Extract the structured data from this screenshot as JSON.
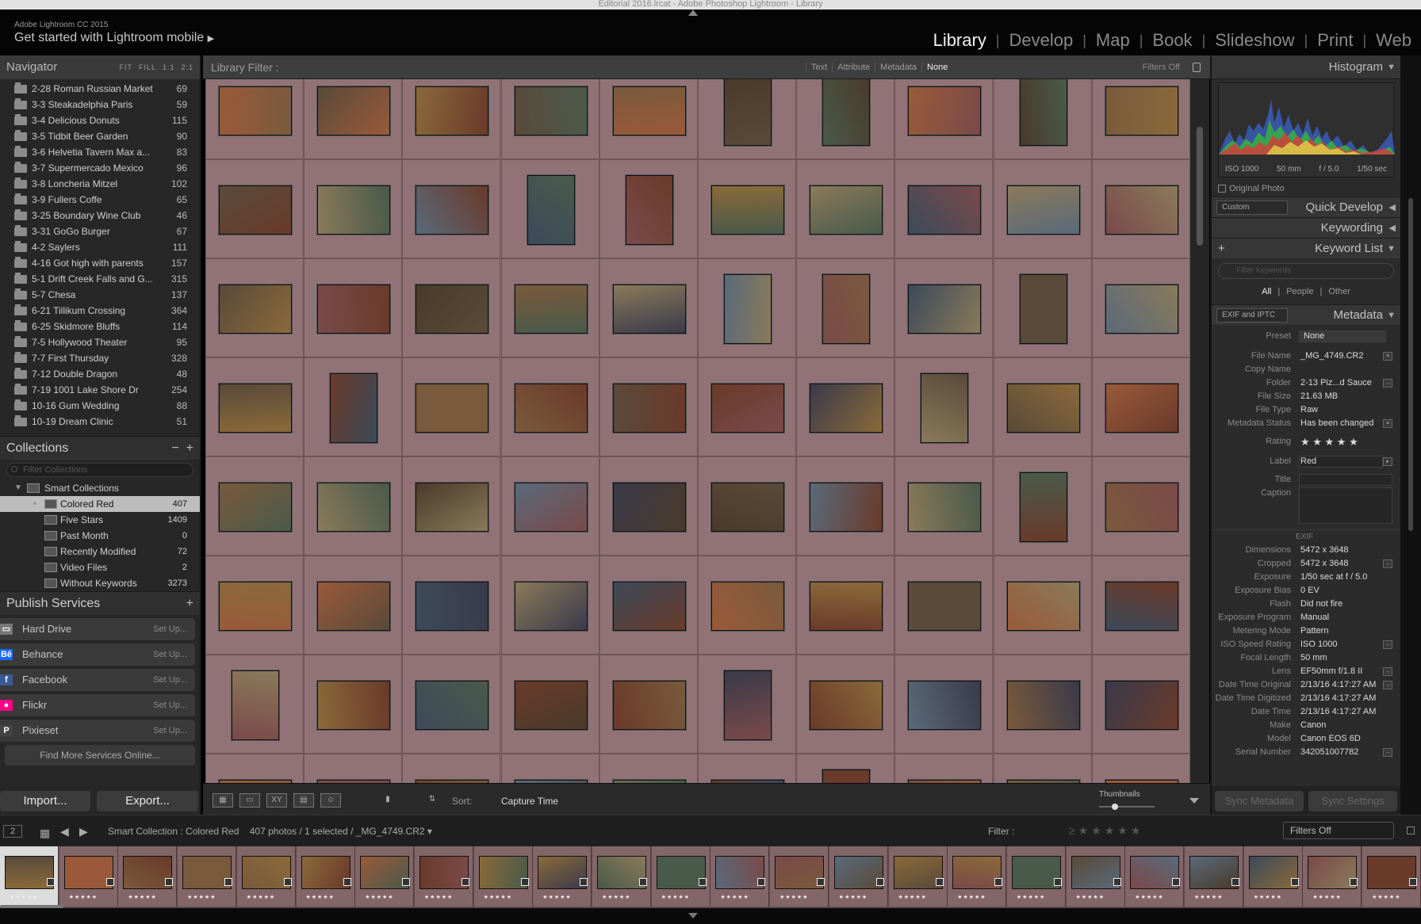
{
  "window": {
    "title": "Editorial 2016.lrcat - Adobe Photoshop Lightroom - Library"
  },
  "identity": {
    "app": "Adobe Lightroom CC 2015",
    "mobile_prompt": "Get started with Lightroom mobile"
  },
  "modules": [
    "Library",
    "Develop",
    "Map",
    "Book",
    "Slideshow",
    "Print",
    "Web"
  ],
  "active_module": "Library",
  "navigator": {
    "title": "Navigator",
    "zoom_options": [
      "FIT",
      "FILL",
      "1:1",
      "2:1"
    ]
  },
  "folders": [
    {
      "name": "2-28 Roman Russian Market",
      "count": "69"
    },
    {
      "name": "3-3 Steakadelphia Paris",
      "count": "59"
    },
    {
      "name": "3-4 Delicious Donuts",
      "count": "115"
    },
    {
      "name": "3-5 Tidbit Beer Garden",
      "count": "90"
    },
    {
      "name": "3-6 Helvetia Tavern Max a...",
      "count": "83"
    },
    {
      "name": "3-7 Supermercado Mexico",
      "count": "96"
    },
    {
      "name": "3-8 Loncheria Mitzel",
      "count": "102"
    },
    {
      "name": "3-9 Fullers Coffe",
      "count": "65"
    },
    {
      "name": "3-25 Boundary Wine Club",
      "count": "46"
    },
    {
      "name": "3-31 GoGo Burger",
      "count": "67"
    },
    {
      "name": "4-2 Saylers",
      "count": "111"
    },
    {
      "name": "4-16 Got high with parents",
      "count": "157"
    },
    {
      "name": "5-1 Drift Creek Falls and G...",
      "count": "315"
    },
    {
      "name": "5-7 Chesa",
      "count": "137"
    },
    {
      "name": "6-21 Tillikum Crossing",
      "count": "364"
    },
    {
      "name": "6-25 Skidmore Bluffs",
      "count": "114"
    },
    {
      "name": "7-5 Hollywood Theater",
      "count": "95"
    },
    {
      "name": "7-7 First Thursday",
      "count": "328"
    },
    {
      "name": "7-12 Double Dragon",
      "count": "48"
    },
    {
      "name": "7-19 1001 Lake Shore Dr",
      "count": "254"
    },
    {
      "name": "10-16 Gum Wedding",
      "count": "88"
    },
    {
      "name": "10-19 Dream Clinic",
      "count": "51"
    }
  ],
  "collections": {
    "title": "Collections",
    "filter_placeholder": "Filter Collections",
    "group": "Smart Collections",
    "items": [
      {
        "name": "Colored Red",
        "count": "407"
      },
      {
        "name": "Five Stars",
        "count": "1409"
      },
      {
        "name": "Past Month",
        "count": "0"
      },
      {
        "name": "Recently Modified",
        "count": "72"
      },
      {
        "name": "Video Files",
        "count": "2"
      },
      {
        "name": "Without Keywords",
        "count": "3273"
      }
    ]
  },
  "publish": {
    "title": "Publish Services",
    "services": [
      {
        "name": "Hard Drive",
        "action": "Set Up...",
        "icon": "hard-drive-icon"
      },
      {
        "name": "Behance",
        "action": "Set Up...",
        "icon": "behance-icon"
      },
      {
        "name": "Facebook",
        "action": "Set Up...",
        "icon": "facebook-icon"
      },
      {
        "name": "Flickr",
        "action": "Set Up...",
        "icon": "flickr-icon"
      },
      {
        "name": "Pixieset",
        "action": "Set Up...",
        "icon": "pixieset-icon"
      }
    ],
    "find_more": "Find More Services Online..."
  },
  "left_buttons": {
    "import": "Import...",
    "export": "Export..."
  },
  "library_filter": {
    "title": "Library Filter :",
    "options": [
      "Text",
      "Attribute",
      "Metadata",
      "None"
    ],
    "active": "None",
    "filters_state": "Filters Off"
  },
  "grid": {
    "tint": "#917377",
    "columns": 10,
    "rows": 8
  },
  "toolbar": {
    "sort_label": "Sort:",
    "sort_value": "Capture Time",
    "thumbnails_label": "Thumbnails",
    "view_icons": [
      "grid-view-icon",
      "loupe-view-icon",
      "compare-view-icon",
      "survey-view-icon",
      "people-view-icon"
    ]
  },
  "right": {
    "histogram": {
      "title": "Histogram",
      "iso": "ISO 1000",
      "focal": "50 mm",
      "aperture": "f / 5.0",
      "shutter": "1/50 sec",
      "original_photo": "Original Photo"
    },
    "quick_develop": {
      "title": "Quick Develop",
      "preset": "Custom"
    },
    "keywording": {
      "title": "Keywording"
    },
    "keyword_list": {
      "title": "Keyword List",
      "filter_placeholder": "Filter Keywords",
      "tabs": [
        "All",
        "People",
        "Other"
      ],
      "active_tab": "All"
    },
    "metadata": {
      "title": "Metadata",
      "set": "EXIF and IPTC",
      "preset_label": "Preset",
      "preset_value": "None",
      "fields": [
        {
          "k": "File Name",
          "v": "_MG_4749.CR2"
        },
        {
          "k": "Copy Name",
          "v": ""
        },
        {
          "k": "Folder",
          "v": "2-13 Piz...d Sauce"
        },
        {
          "k": "File Size",
          "v": "21.63 MB"
        },
        {
          "k": "File Type",
          "v": "Raw"
        },
        {
          "k": "Metadata Status",
          "v": "Has been changed"
        }
      ],
      "rating_label": "Rating",
      "rating": "★ ★ ★ ★ ★",
      "label_label": "Label",
      "label_value": "Red",
      "title_label": "Title",
      "caption_label": "Caption",
      "exif_header": "EXIF",
      "exif": [
        {
          "k": "Dimensions",
          "v": "5472 x 3648"
        },
        {
          "k": "Cropped",
          "v": "5472 x 3648"
        },
        {
          "k": "Exposure",
          "v": "1/50 sec at f / 5.0"
        },
        {
          "k": "Exposure Bias",
          "v": "0 EV"
        },
        {
          "k": "Flash",
          "v": "Did not fire"
        },
        {
          "k": "Exposure Program",
          "v": "Manual"
        },
        {
          "k": "Metering Mode",
          "v": "Pattern"
        },
        {
          "k": "ISO Speed Rating",
          "v": "ISO 1000"
        },
        {
          "k": "Focal Length",
          "v": "50 mm"
        },
        {
          "k": "Lens",
          "v": "EF50mm f/1.8 II"
        },
        {
          "k": "Date Time Original",
          "v": "2/13/16 4:17:27 AM"
        },
        {
          "k": "Date Time Digitized",
          "v": "2/13/16 4:17:27 AM"
        },
        {
          "k": "Date Time",
          "v": "2/13/16 4:17:27 AM"
        },
        {
          "k": "Make",
          "v": "Canon"
        },
        {
          "k": "Model",
          "v": "Canon EOS 6D"
        },
        {
          "k": "Serial Number",
          "v": "342051007782"
        }
      ]
    },
    "sync_metadata": "Sync Metadata",
    "sync_settings": "Sync Settings"
  },
  "filmstrip": {
    "page": "2",
    "source": "Smart Collection : Colored Red",
    "status": "407 photos / 1 selected / _MG_4749.CR2 ▾",
    "filter_label": "Filter :",
    "filters_off": "Filters Off",
    "count": 24
  }
}
